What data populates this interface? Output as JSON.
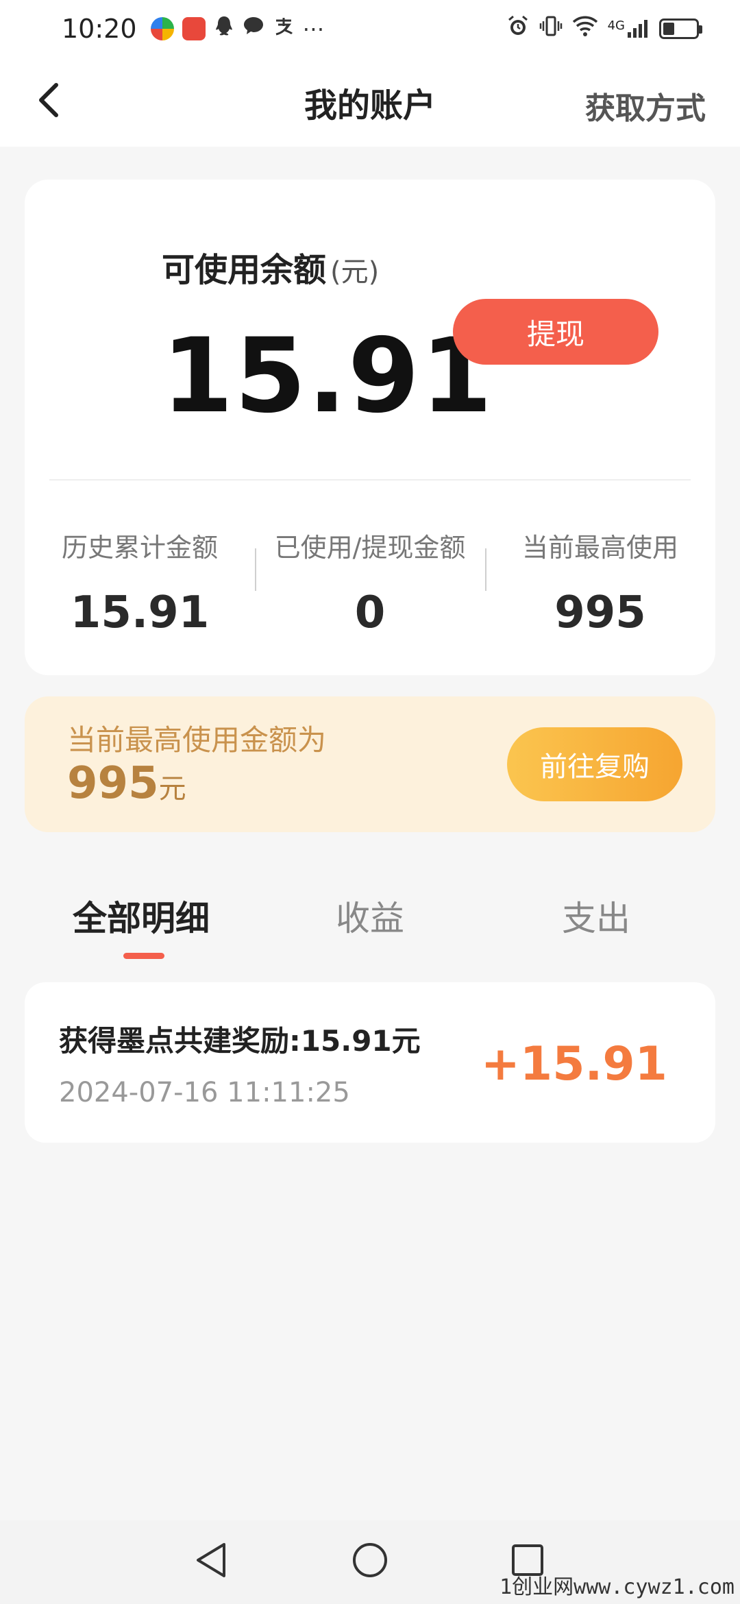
{
  "status_bar": {
    "time": "10:20",
    "network": "4G",
    "icons": [
      "colorful-app-icon",
      "huawei-app-icon",
      "qq-icon",
      "chat-bubble-icon",
      "alipay-icon",
      "more-icon",
      "alarm-icon",
      "vibrate-icon",
      "wifi-icon",
      "signal-icon",
      "battery-icon"
    ]
  },
  "header": {
    "title": "我的账户",
    "right_link": "获取方式"
  },
  "balance": {
    "label": "可使用余额",
    "unit": "(元)",
    "value": "15.91",
    "withdraw_label": "提现"
  },
  "stats": [
    {
      "label": "历史累计金额",
      "value": "15.91"
    },
    {
      "label": "已使用/提现金额",
      "value": "0"
    },
    {
      "label": "当前最高使用",
      "value": "995"
    }
  ],
  "promo": {
    "text": "当前最高使用金额为",
    "amount": "995",
    "amount_unit": "元",
    "button_label": "前往复购"
  },
  "tabs": [
    {
      "label": "全部明细",
      "active": true
    },
    {
      "label": "收益",
      "active": false
    },
    {
      "label": "支出",
      "active": false
    }
  ],
  "records": [
    {
      "title": "获得墨点共建奖励:15.91元",
      "time": "2024-07-16 11:11:25",
      "amount": "+15.91"
    }
  ],
  "watermark": "1创业网www.cywz1.com",
  "colors": {
    "accent": "#f45f4c",
    "amount": "#f47b3f",
    "promo_bg": "#fdf1dc",
    "promo_text": "#c9924d",
    "button_gradient_start": "#fbc54f",
    "button_gradient_end": "#f6a531"
  }
}
